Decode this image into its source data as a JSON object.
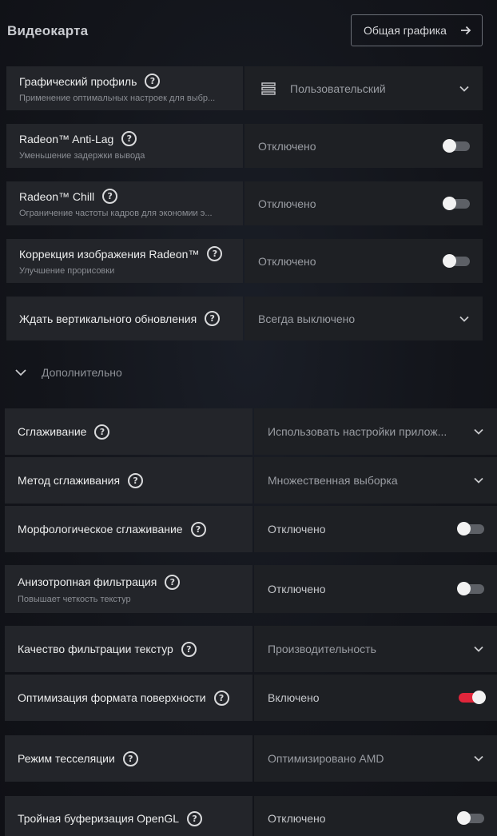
{
  "header": {
    "title": "Видеокарта",
    "overview_button": "Общая графика"
  },
  "colors": {
    "toggle_on": "#e0263b",
    "toggle_off": "#5d6066",
    "panel_left": "#23252a",
    "panel_right": "#1e2024"
  },
  "rows": [
    {
      "title": "Графический профиль",
      "subtitle": "Применение оптимальных настроек для выбр...",
      "value": "Пользовательский",
      "control": "dropdown",
      "icon": "profile-list-icon"
    },
    {
      "title": "Radeon™ Anti-Lag",
      "subtitle": "Уменьшение задержки вывода",
      "value": "Отключено",
      "control": "toggle",
      "state": false
    },
    {
      "title": "Radeon™ Chill",
      "subtitle": "Ограничение частоты кадров для экономии э...",
      "value": "Отключено",
      "control": "toggle",
      "state": false
    },
    {
      "title": "Коррекция изображения Radeon™",
      "subtitle": "Улучшение прорисовки",
      "value": "Отключено",
      "control": "toggle",
      "state": false
    },
    {
      "title": "Ждать вертикального обновления",
      "value": "Всегда выключено",
      "control": "dropdown"
    }
  ],
  "advanced": {
    "label": "Дополнительно",
    "expanded": true,
    "rows": [
      {
        "title": "Сглаживание",
        "value": "Использовать настройки прилож...",
        "control": "dropdown"
      },
      {
        "title": "Метод сглаживания",
        "value": "Множественная выборка",
        "control": "dropdown"
      },
      {
        "title": "Морфологическое сглаживание",
        "value": "Отключено",
        "control": "toggle",
        "state": false
      },
      {
        "title": "Анизотропная фильтрация",
        "subtitle": "Повышает четкость текстур",
        "value": "Отключено",
        "control": "toggle",
        "state": false
      },
      {
        "title": "Качество фильтрации текстур",
        "value": "Производительность",
        "control": "dropdown"
      },
      {
        "title": "Оптимизация формата поверхности",
        "value": "Включено",
        "control": "toggle",
        "state": true
      },
      {
        "title": "Режим тесселяции",
        "value": "Оптимизировано AMD",
        "control": "dropdown"
      },
      {
        "title": "Тройная буферизация OpenGL",
        "value": "Отключено",
        "control": "toggle",
        "state": false
      }
    ]
  }
}
